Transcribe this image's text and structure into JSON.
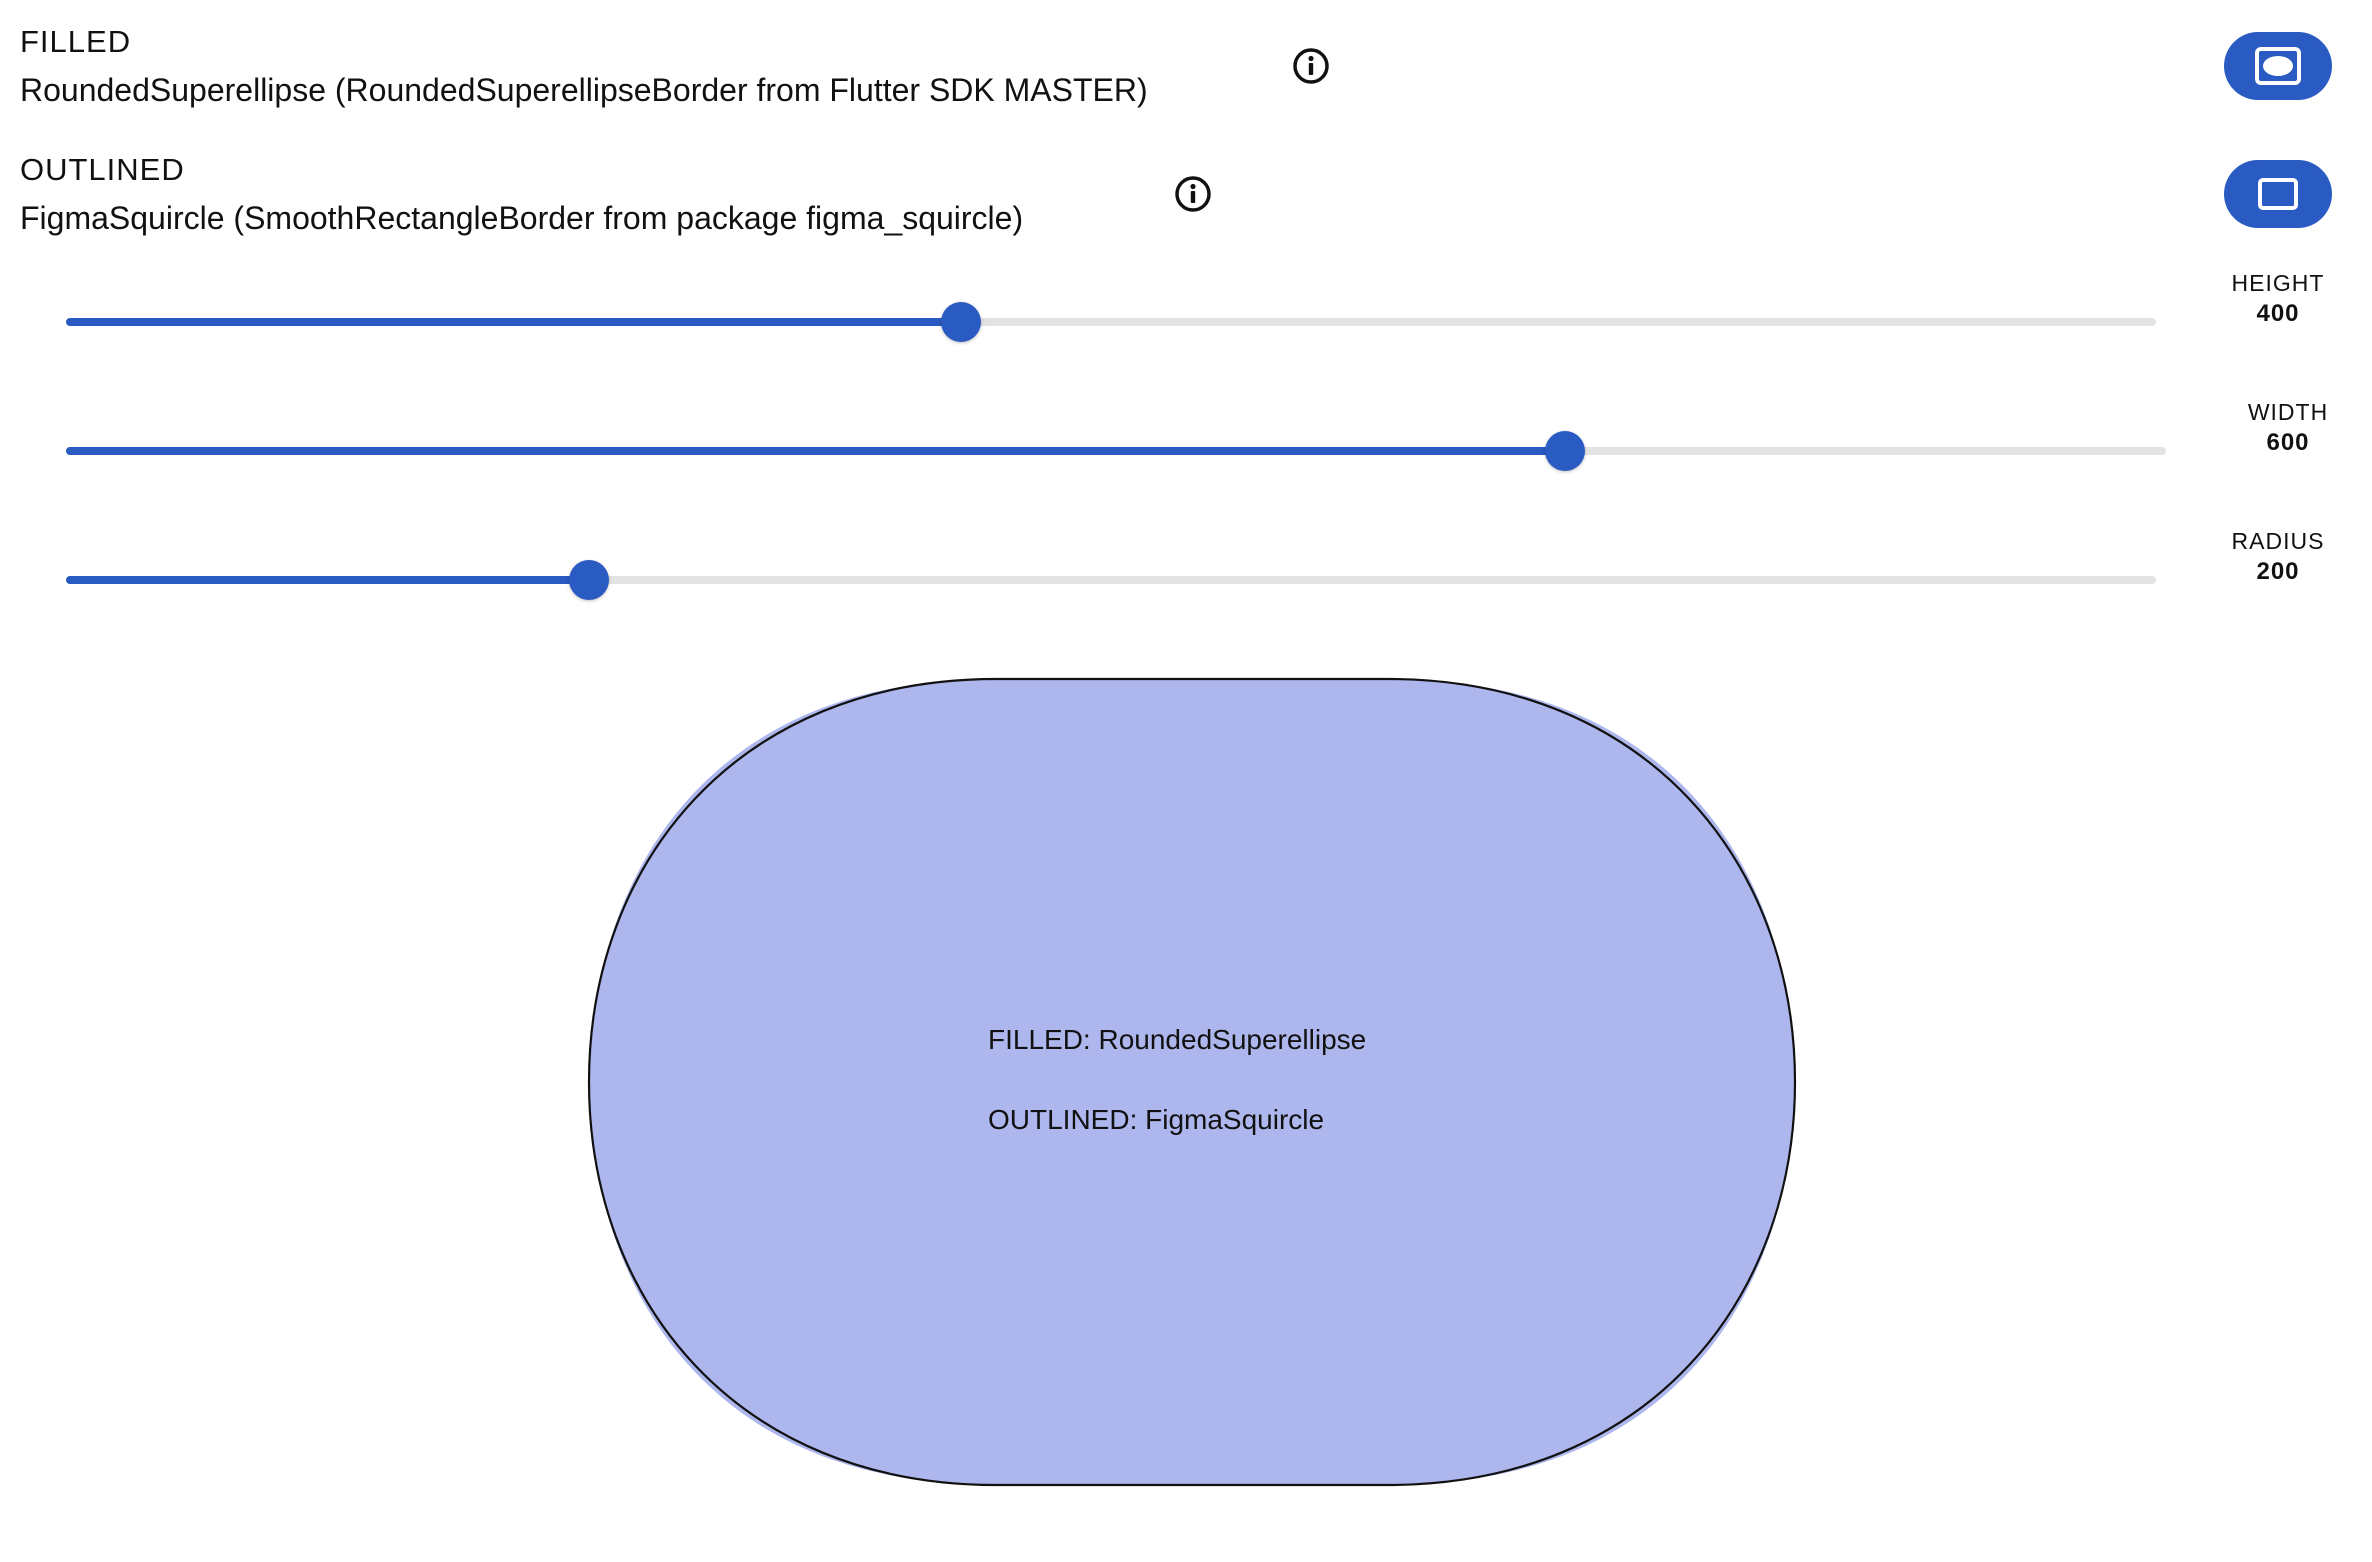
{
  "modes": [
    {
      "label": "FILLED",
      "description": "RoundedSuperellipse (RoundedSuperellipseBorder from Flutter SDK MASTER)",
      "info_icon": "info-circle-icon",
      "toggle_icon": "rounded-superellipse-filled-icon"
    },
    {
      "label": "OUTLINED",
      "description": "FigmaSquircle (SmoothRectangleBorder from package figma_squircle)",
      "info_icon": "info-circle-icon",
      "toggle_icon": "rectangle-outline-icon"
    }
  ],
  "sliders": [
    {
      "name": "HEIGHT",
      "value": "400",
      "fraction": 0.428
    },
    {
      "name": "WIDTH",
      "value": "600",
      "fraction": 0.714
    },
    {
      "name": "RADIUS",
      "value": "200",
      "fraction": 0.25
    }
  ],
  "preview": {
    "filled_text": "FILLED: RoundedSuperellipse",
    "outlined_text": "OUTLINED: FigmaSquircle"
  },
  "colors": {
    "accent": "#2a5bc2",
    "track": "#e3e3e3",
    "shape_fill": "#adb6ed",
    "shape_outline": "#111111"
  }
}
